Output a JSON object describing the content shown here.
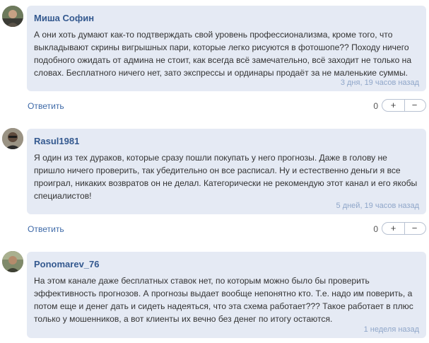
{
  "comments": [
    {
      "author": "Миша Софин",
      "text": "А они хоть думают как-то подтверждать свой уровень профессионализма, кроме того, что выкладывают скрины вигрышных пари, которые легко рисуются в фотошопе?? Походу ничего подобного ожидать от админа не стоит, как всегда всё замечательно, всё заходит не только на словах. Бесплатного ничего нет, зато экспрессы и ординары продаёт за не маленькие суммы.",
      "time": "3 дня, 19 часов назад",
      "reply_label": "Ответить",
      "votes": "0",
      "plus": "+",
      "minus": "−"
    },
    {
      "author": "Rasul1981",
      "text": "Я один из тех дураков, которые сразу пошли покупать у него прогнозы. Даже в голову не пришло ничего проверить, так убедительно он все расписал. Ну и естественно деньги я все проиграл, никаких возвратов он не делал. Категорически не рекомендую этот канал и его якобы специалистов!",
      "time": "5 дней, 19 часов назад",
      "reply_label": "Ответить",
      "votes": "0",
      "plus": "+",
      "minus": "−"
    },
    {
      "author": "Ponomarev_76",
      "text": "На этом канале даже бесплатных ставок нет, по которым можно было бы проверить эффективность прогнозов. А прогнозы выдает вообще непонятно кто. Т.е. надо им поверить, а потом еще и денег дать и сидеть надеяться, что эта схема работает??? Такое работает в плюс только у мошенников, а вот клиенты их вечно без денег по итогу остаются.",
      "time": "1 неделя назад"
    }
  ]
}
